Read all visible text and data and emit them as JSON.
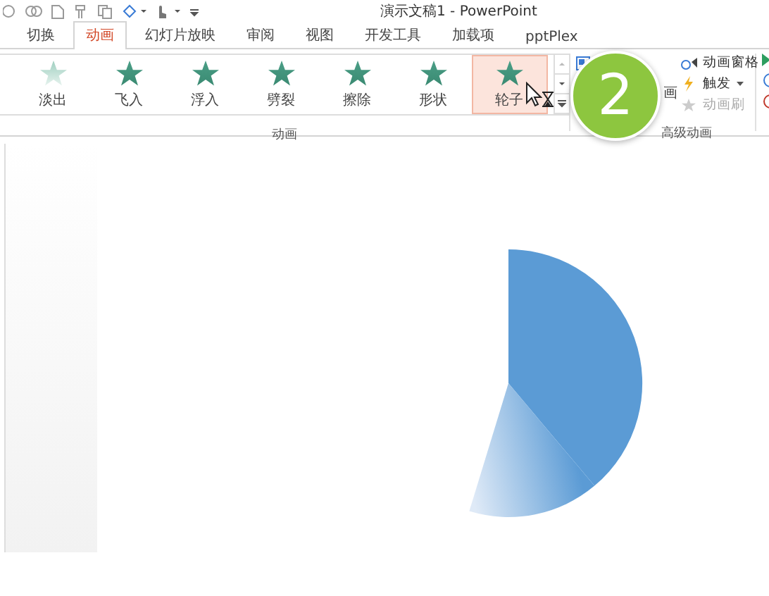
{
  "window": {
    "title": "演示文稿1 - PowerPoint"
  },
  "tabs": [
    {
      "label": "切换",
      "selected": false
    },
    {
      "label": "动画",
      "selected": true
    },
    {
      "label": "幻灯片放映",
      "selected": false
    },
    {
      "label": "审阅",
      "selected": false
    },
    {
      "label": "视图",
      "selected": false
    },
    {
      "label": "开发工具",
      "selected": false
    },
    {
      "label": "加载项",
      "selected": false
    },
    {
      "label": "pptPlex",
      "selected": false
    }
  ],
  "animations": {
    "group_label": "动画",
    "items": [
      {
        "label": "淡出",
        "selected": false
      },
      {
        "label": "飞入",
        "selected": false
      },
      {
        "label": "浮入",
        "selected": false
      },
      {
        "label": "劈裂",
        "selected": false
      },
      {
        "label": "擦除",
        "selected": false
      },
      {
        "label": "形状",
        "selected": false
      },
      {
        "label": "轮子",
        "selected": true
      }
    ]
  },
  "advanced": {
    "group_label": "高级动画",
    "add_label": "画",
    "items": [
      {
        "label": "动画窗格",
        "disabled": false,
        "has_menu": false
      },
      {
        "label": "触发",
        "disabled": false,
        "has_menu": true
      },
      {
        "label": "动画刷",
        "disabled": true,
        "has_menu": false
      }
    ]
  },
  "step_badge": "2"
}
